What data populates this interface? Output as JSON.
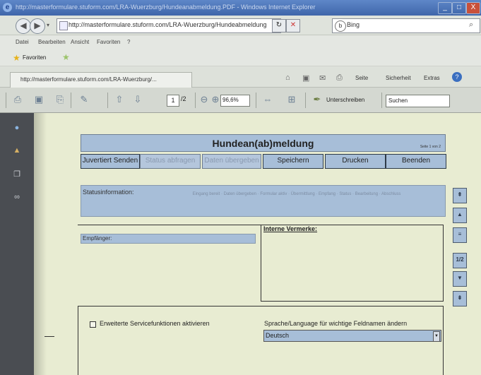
{
  "window": {
    "title": "http://masterformulare.stuform.com/LRA-Wuerzburg/Hundeanabmeldung.PDF - Windows Internet Explorer",
    "controls": [
      "_",
      "□",
      "X"
    ]
  },
  "address_bar": {
    "url": "http://masterformulare.stuform.com/LRA-Wuerzburg/Hundeabmeldung",
    "search_placeholder": "Bing"
  },
  "menu": [
    "Datei",
    "Bearbeiten",
    "Ansicht",
    "Favoriten",
    "?"
  ],
  "favorites": {
    "label": "Favoriten"
  },
  "tab": {
    "label": "http://masterformulare.stuform.com/LRA-Wuerzburg/...",
    "commands": [
      "Seite",
      "Sicherheit",
      "Extras"
    ]
  },
  "pdf_toolbar": {
    "page_current": "1",
    "page_total": "/2",
    "zoom": "96,6%",
    "sign_label": "Unterschreiben",
    "search_placeholder": "Suchen"
  },
  "form": {
    "title": "Hundean(ab)meldung",
    "page_indicator": "Seite 1 von 2",
    "buttons": {
      "send": "Juvertiert Senden",
      "status_ask": "Status abfragen",
      "data_transfer": "Daten übergeben",
      "save": "Speichern",
      "print": "Drucken",
      "exit": "Beenden"
    },
    "status_label": "Statusinformation:",
    "status_faint": "Eingang bereit · Daten übergeben · Formular aktiv · Übermittlung · Empfang · Status · Bearbeitung · Abschluss",
    "recipient_label": "Empfänger:",
    "internal_notes_label": "Interne Vermerke:",
    "service_label": "Erweiterte Servicefunktionen aktivieren",
    "language_label": "Sprache/Language für wichtige Feldnamen ändern",
    "language_value": "Deutsch"
  },
  "side_nav": [
    "⇞",
    "▲",
    "≡",
    "1/2",
    "▼",
    "⇟"
  ]
}
